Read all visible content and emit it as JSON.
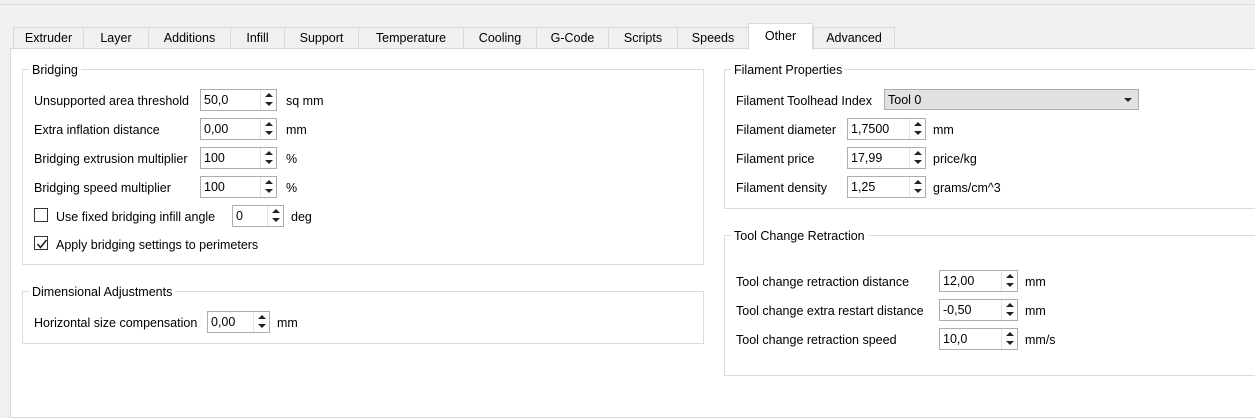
{
  "tabs": [
    "Extruder",
    "Layer",
    "Additions",
    "Infill",
    "Support",
    "Temperature",
    "Cooling",
    "G-Code",
    "Scripts",
    "Speeds",
    "Other",
    "Advanced"
  ],
  "active_tab": "Other",
  "bridging": {
    "title": "Bridging",
    "unsupported_area": {
      "label": "Unsupported area threshold",
      "value": "50,0",
      "unit": "sq mm"
    },
    "extra_inflation": {
      "label": "Extra inflation distance",
      "value": "0,00",
      "unit": "mm"
    },
    "extrusion_mult": {
      "label": "Bridging extrusion multiplier",
      "value": "100",
      "unit": "%"
    },
    "speed_mult": {
      "label": "Bridging speed multiplier",
      "value": "100",
      "unit": "%"
    },
    "fixed_angle": {
      "label": "Use fixed bridging infill angle",
      "checked": false,
      "value": "0",
      "unit": "deg"
    },
    "apply_perimeters": {
      "label": "Apply bridging settings to perimeters",
      "checked": true
    }
  },
  "dimensional": {
    "title": "Dimensional Adjustments",
    "horizontal_comp": {
      "label": "Horizontal size compensation",
      "value": "0,00",
      "unit": "mm"
    }
  },
  "filament": {
    "title": "Filament Properties",
    "toolhead_index": {
      "label": "Filament Toolhead Index",
      "value": "Tool 0"
    },
    "diameter": {
      "label": "Filament diameter",
      "value": "1,7500",
      "unit": "mm"
    },
    "price": {
      "label": "Filament price",
      "value": "17,99",
      "unit": "price/kg"
    },
    "density": {
      "label": "Filament density",
      "value": "1,25",
      "unit": "grams/cm^3"
    }
  },
  "tool_change": {
    "title": "Tool Change Retraction",
    "retraction_distance": {
      "label": "Tool change retraction distance",
      "value": "12,00",
      "unit": "mm"
    },
    "extra_restart": {
      "label": "Tool change extra restart distance",
      "value": "-0,50",
      "unit": "mm"
    },
    "retraction_speed": {
      "label": "Tool change retraction speed",
      "value": "10,0",
      "unit": "mm/s"
    }
  }
}
